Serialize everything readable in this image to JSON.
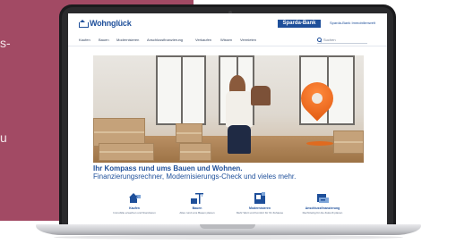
{
  "page": {
    "left_text_fragments": [
      "s-",
      "u"
    ]
  },
  "site": {
    "logo_text": "Wohnglück",
    "bank_label": "Sparda-Bank",
    "header_link": "Sparda-Bank Immobilienwelt",
    "nav": [
      "Kaufen",
      "Bauen",
      "Modernisieren",
      "Anschlussfinanzierung",
      "Verkaufen",
      "Wissen",
      "Vermieten"
    ],
    "search_placeholder": "Suchen",
    "hero_title": "Ihr Kompass rund ums Bauen und Wohnen.",
    "hero_subtitle": "Finanzierungsrechner, Modernisierungs-Check und vieles mehr.",
    "categories": [
      {
        "label": "Kaufen",
        "desc": "Immobilie erwerben und finanzieren",
        "icon": "house-purchase-icon"
      },
      {
        "label": "Bauen",
        "desc": "Alles rund ums Bauen planen",
        "icon": "crane-icon"
      },
      {
        "label": "Modernisieren",
        "desc": "Mehr Wert und Komfort für Ihr Zuhause",
        "icon": "renovation-icon"
      },
      {
        "label": "Anschlussfinanzierung",
        "desc": "Rechtzeitig für die Zukunft planen",
        "icon": "financing-icon"
      }
    ]
  },
  "colors": {
    "panel": "#a24a64",
    "brand_blue": "#1e4f9a",
    "accent_orange": "#e35b12"
  }
}
